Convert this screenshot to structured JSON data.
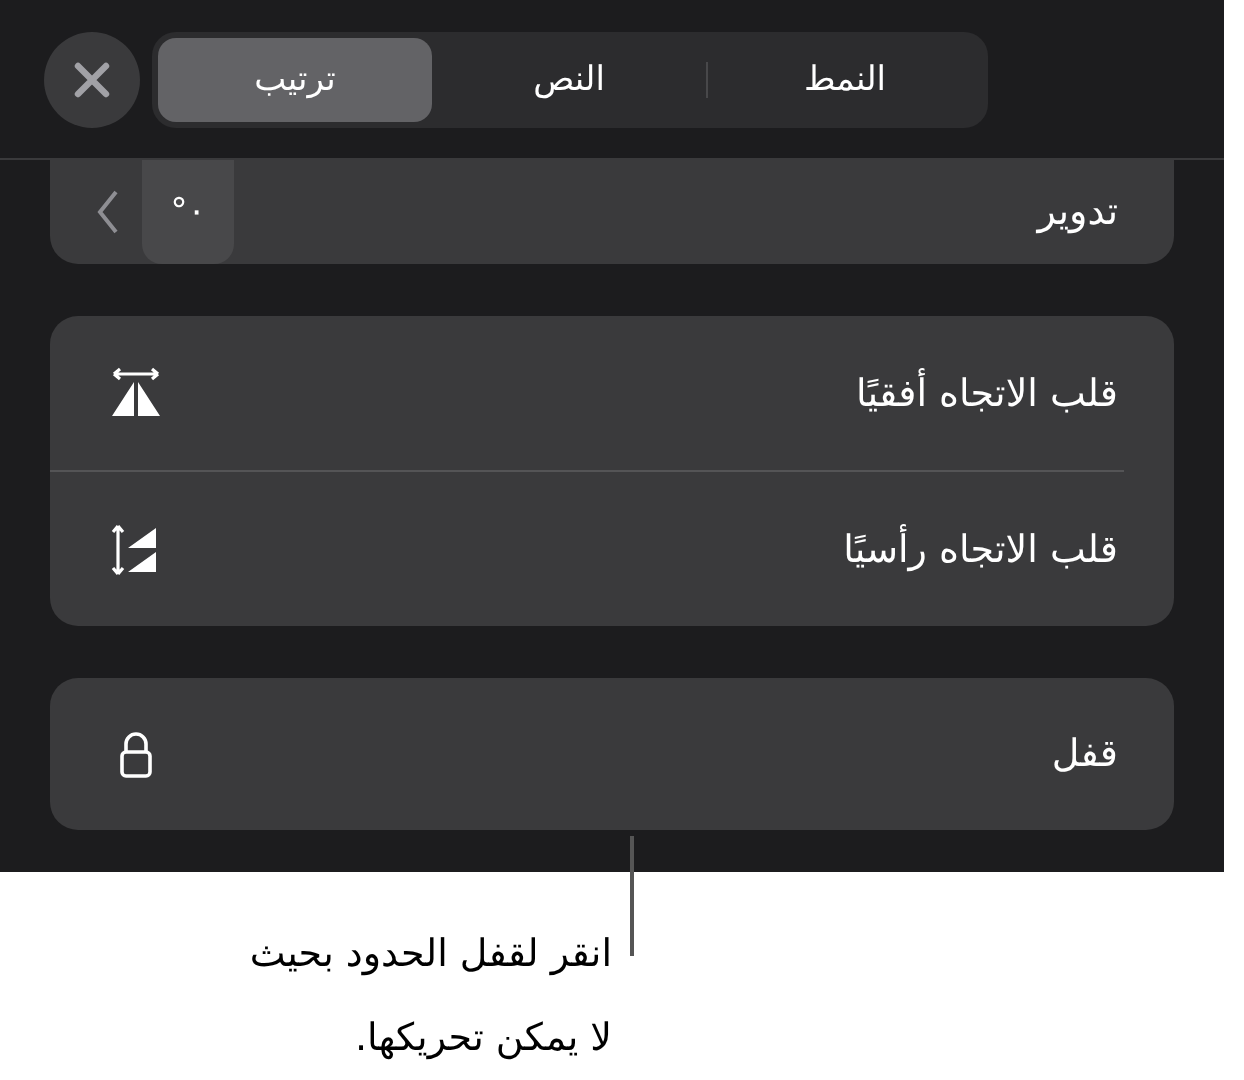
{
  "tabs": [
    {
      "label": "النمط",
      "selected": false
    },
    {
      "label": "النص",
      "selected": false
    },
    {
      "label": "ترتيب",
      "selected": true
    }
  ],
  "rotation": {
    "label": "تدوير",
    "value": "٠°"
  },
  "flip_rows": [
    {
      "label": "قلب الاتجاه أفقيًا",
      "kind": "horizontal"
    },
    {
      "label": "قلب الاتجاه رأسيًا",
      "kind": "vertical"
    }
  ],
  "lock": {
    "label": "قفل"
  },
  "callout": "انقر لقفل الحدود بحيث\nلا يمكن تحريكها."
}
